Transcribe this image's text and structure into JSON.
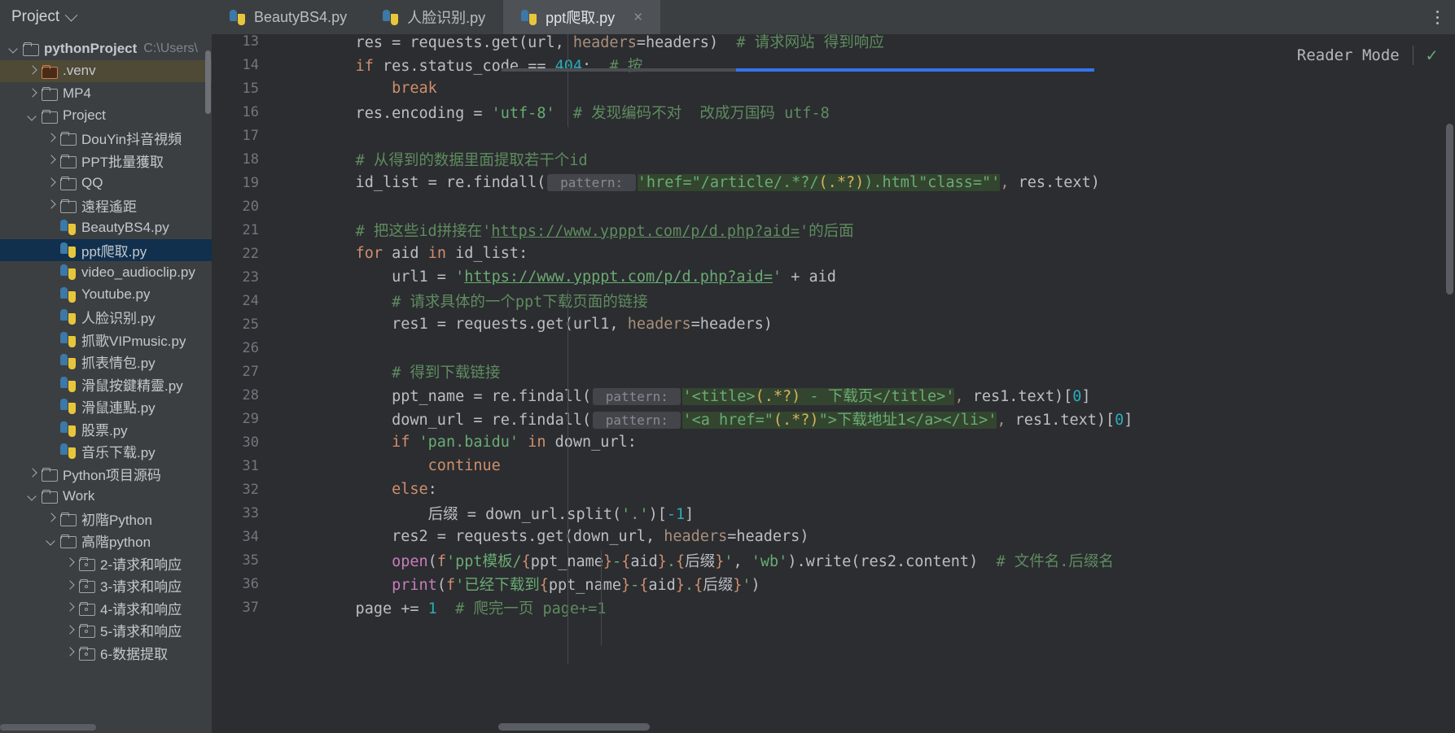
{
  "window": {
    "project_button_label": "Project",
    "kebab_icon": "more-vertical-icon"
  },
  "tabs": [
    {
      "label": "BeautyBS4.py",
      "active": false,
      "icon": "python-file-icon"
    },
    {
      "label": "人脸识别.py",
      "active": false,
      "icon": "python-file-icon"
    },
    {
      "label": "ppt爬取.py",
      "active": true,
      "icon": "python-file-icon",
      "close": "×"
    }
  ],
  "reader_mode": {
    "label": "Reader Mode",
    "check_icon": "check-icon"
  },
  "sidebar": {
    "items": [
      {
        "indent": 0,
        "arrow": "down",
        "icon": "folder-icon",
        "label": "pythonProject",
        "path": "C:\\Users\\",
        "bold": true
      },
      {
        "indent": 1,
        "arrow": "right",
        "icon": "folder-venv-icon",
        "label": ".venv",
        "selected": "olive"
      },
      {
        "indent": 1,
        "arrow": "right",
        "icon": "folder-icon",
        "label": "MP4"
      },
      {
        "indent": 1,
        "arrow": "down",
        "icon": "folder-icon",
        "label": "Project"
      },
      {
        "indent": 2,
        "arrow": "right",
        "icon": "folder-icon",
        "label": "DouYin抖音視頻"
      },
      {
        "indent": 2,
        "arrow": "right",
        "icon": "folder-icon",
        "label": "PPT批量獲取"
      },
      {
        "indent": 2,
        "arrow": "right",
        "icon": "folder-icon",
        "label": "QQ"
      },
      {
        "indent": 2,
        "arrow": "right",
        "icon": "folder-icon",
        "label": "遠程遙距"
      },
      {
        "indent": 2,
        "arrow": "none",
        "icon": "python-file-icon",
        "label": "BeautyBS4.py"
      },
      {
        "indent": 2,
        "arrow": "none",
        "icon": "python-file-icon",
        "label": "ppt爬取.py",
        "selected": "blue"
      },
      {
        "indent": 2,
        "arrow": "none",
        "icon": "python-file-icon",
        "label": "video_audioclip.py"
      },
      {
        "indent": 2,
        "arrow": "none",
        "icon": "python-file-icon",
        "label": "Youtube.py"
      },
      {
        "indent": 2,
        "arrow": "none",
        "icon": "python-file-icon",
        "label": "人脸识别.py"
      },
      {
        "indent": 2,
        "arrow": "none",
        "icon": "python-file-icon",
        "label": "抓歌VIPmusic.py"
      },
      {
        "indent": 2,
        "arrow": "none",
        "icon": "python-file-icon",
        "label": "抓表情包.py"
      },
      {
        "indent": 2,
        "arrow": "none",
        "icon": "python-file-icon",
        "label": "滑鼠按鍵精靈.py"
      },
      {
        "indent": 2,
        "arrow": "none",
        "icon": "python-file-icon",
        "label": "滑鼠連點.py"
      },
      {
        "indent": 2,
        "arrow": "none",
        "icon": "python-file-icon",
        "label": "股票.py"
      },
      {
        "indent": 2,
        "arrow": "none",
        "icon": "python-file-icon",
        "label": "音乐下载.py"
      },
      {
        "indent": 1,
        "arrow": "right",
        "icon": "folder-icon",
        "label": "Python项目源码"
      },
      {
        "indent": 1,
        "arrow": "down",
        "icon": "folder-icon",
        "label": "Work"
      },
      {
        "indent": 2,
        "arrow": "right",
        "icon": "folder-icon",
        "label": "初階Python"
      },
      {
        "indent": 2,
        "arrow": "down",
        "icon": "folder-icon",
        "label": "高階python"
      },
      {
        "indent": 3,
        "arrow": "right",
        "icon": "folder-module-icon",
        "label": "2-请求和响应"
      },
      {
        "indent": 3,
        "arrow": "right",
        "icon": "folder-module-icon",
        "label": "3-请求和响应"
      },
      {
        "indent": 3,
        "arrow": "right",
        "icon": "folder-module-icon",
        "label": "4-请求和响应"
      },
      {
        "indent": 3,
        "arrow": "right",
        "icon": "folder-module-icon",
        "label": "5-请求和响应"
      },
      {
        "indent": 3,
        "arrow": "right",
        "icon": "folder-module-icon",
        "label": "6-数据提取"
      }
    ]
  },
  "editor": {
    "filename": "ppt爬取.py",
    "first_visible_line": 13,
    "last_visible_line": 37,
    "lines": [
      {
        "n": "13",
        "raw": "    res = requests.get(url, headers=headers)  # 请求网站 得到响应"
      },
      {
        "n": "14",
        "raw": "    if res.status_code == 404:  # 按"
      },
      {
        "n": "15",
        "raw": "        break"
      },
      {
        "n": "16",
        "raw": "    res.encoding = 'utf-8'  # 发现编码不对  改成万国码 utf-8"
      },
      {
        "n": "17",
        "raw": ""
      },
      {
        "n": "18",
        "raw": "    # 从得到的数据里面提取若干个id"
      },
      {
        "n": "19",
        "raw": "    id_list = re.findall( pattern: 'href=\"/article/.*?/(.*?).html\"class=\"', res.text)"
      },
      {
        "n": "20",
        "raw": ""
      },
      {
        "n": "21",
        "raw": "    # 把这些id拼接在'https://www.ypppt.com/p/d.php?aid='的后面"
      },
      {
        "n": "22",
        "raw": "    for aid in id_list:"
      },
      {
        "n": "23",
        "raw": "        url1 = 'https://www.ypppt.com/p/d.php?aid=' + aid"
      },
      {
        "n": "24",
        "raw": "        # 请求具体的一个ppt下载页面的链接"
      },
      {
        "n": "25",
        "raw": "        res1 = requests.get(url1, headers=headers)"
      },
      {
        "n": "26",
        "raw": ""
      },
      {
        "n": "27",
        "raw": "        # 得到下载链接"
      },
      {
        "n": "28",
        "raw": "        ppt_name = re.findall( pattern: '<title>(.*?) - 下载页</title>', res1.text)[0]"
      },
      {
        "n": "29",
        "raw": "        down_url = re.findall( pattern: '<a href=\"(.*?)\">下载地址1</a></li>', res1.text)[0]"
      },
      {
        "n": "30",
        "raw": "        if 'pan.baidu' in down_url:"
      },
      {
        "n": "31",
        "raw": "            continue"
      },
      {
        "n": "32",
        "raw": "        else:"
      },
      {
        "n": "33",
        "raw": "            后缀 = down_url.split('.')[-1]"
      },
      {
        "n": "34",
        "raw": "        res2 = requests.get(down_url, headers=headers)"
      },
      {
        "n": "35",
        "raw": "        open(f'ppt模板/{ppt_name}-{aid}.{后缀}', 'wb').write(res2.content)  # 文件名.后缀名"
      },
      {
        "n": "36",
        "raw": "        print(f'已经下载到{ppt_name}-{aid}.{后缀}')"
      },
      {
        "n": "37",
        "raw": "    page += 1  # 爬完一页 page+=1"
      }
    ],
    "inlay_hint_label": "pattern:"
  },
  "colors": {
    "background": "#2b2d30",
    "panel": "#3c3f41",
    "selection_blue": "#11304d",
    "selection_olive": "#4f4a36",
    "keyword": "#cf8e6d",
    "string": "#6aab73",
    "comment": "#5f8c5f",
    "number": "#2aacb8",
    "text": "#bcbec4",
    "accent": "#3574f0",
    "named_arg": "#aa8f7a",
    "function": "#c77dbb"
  }
}
